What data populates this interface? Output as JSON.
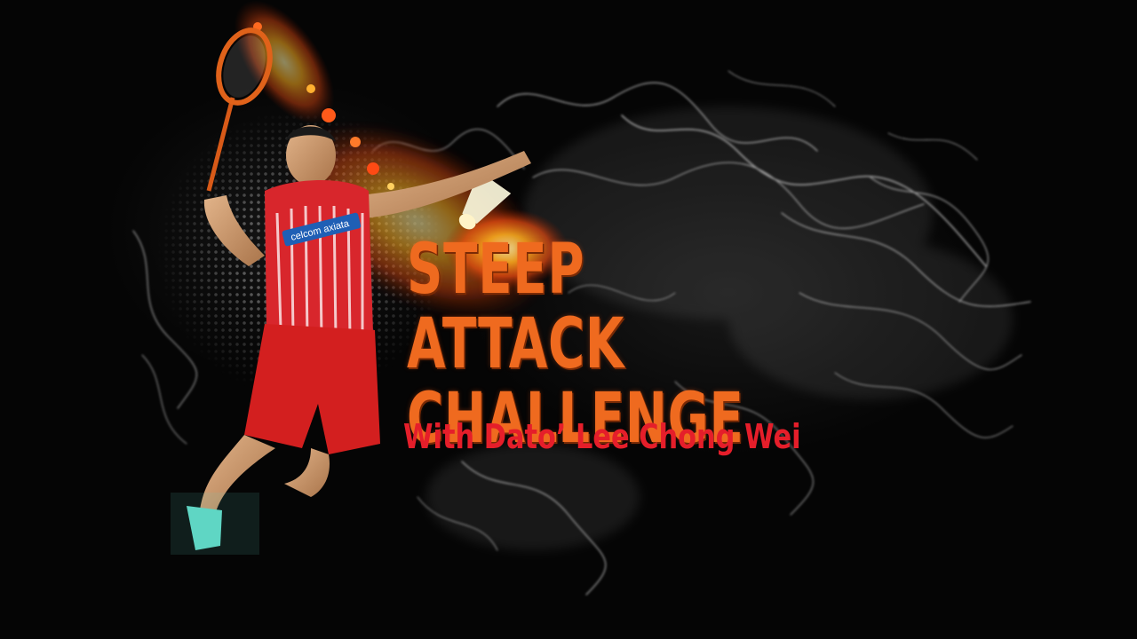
{
  "title": {
    "line1": "STEEP ATTACK",
    "line2": "CHALLENGE"
  },
  "subtitle": "With Dato’ Lee Chong Wei",
  "jersey": {
    "sponsor_text": "celcom axiata"
  },
  "colors": {
    "background": "#050505",
    "title_orange": "#ef6a1f",
    "subtitle_red": "#e51e2a",
    "jersey_red": "#d8262c",
    "shorts_red": "#d31f1f",
    "shoe_teal": "#5fd7c4",
    "smoke": "#cfcfcf"
  },
  "icons": {
    "badminton_racket": "badminton-racket-icon",
    "shuttlecock": "shuttlecock-icon"
  }
}
